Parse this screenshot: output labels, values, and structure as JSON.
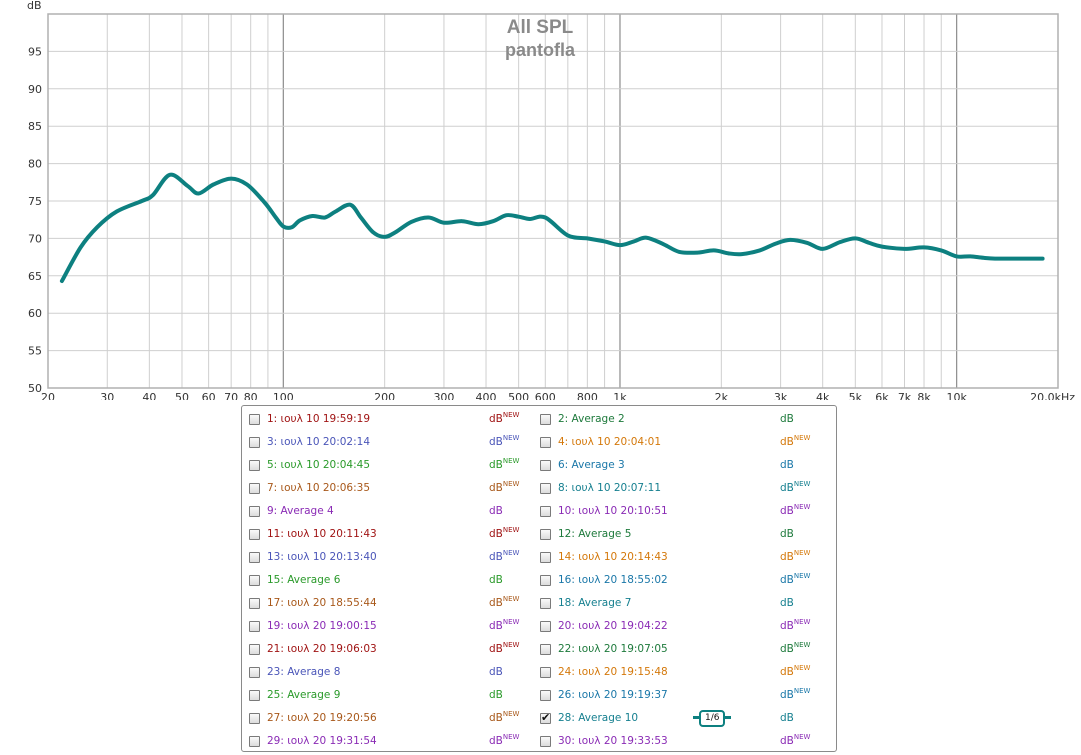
{
  "chart_data": {
    "type": "line",
    "title": "All SPL",
    "subtitle": "pantofla",
    "ylabel": "dB",
    "xlabel": "",
    "x_scale": "log",
    "xlim": [
      20,
      20000
    ],
    "ylim": [
      50,
      100
    ],
    "y_ticks": [
      50,
      55,
      60,
      65,
      70,
      75,
      80,
      85,
      90,
      95
    ],
    "x_ticks": [
      {
        "v": 20,
        "label": "20"
      },
      {
        "v": 30,
        "label": "30"
      },
      {
        "v": 40,
        "label": "40"
      },
      {
        "v": 50,
        "label": "50"
      },
      {
        "v": 60,
        "label": "60"
      },
      {
        "v": 70,
        "label": "70"
      },
      {
        "v": 80,
        "label": "80"
      },
      {
        "v": 100,
        "label": "100"
      },
      {
        "v": 200,
        "label": "200"
      },
      {
        "v": 300,
        "label": "300"
      },
      {
        "v": 400,
        "label": "400"
      },
      {
        "v": 500,
        "label": "500"
      },
      {
        "v": 600,
        "label": "600"
      },
      {
        "v": 800,
        "label": "800"
      },
      {
        "v": 1000,
        "label": "1k"
      },
      {
        "v": 2000,
        "label": "2k"
      },
      {
        "v": 3000,
        "label": "3k"
      },
      {
        "v": 4000,
        "label": "4k"
      },
      {
        "v": 5000,
        "label": "5k"
      },
      {
        "v": 6000,
        "label": "6k"
      },
      {
        "v": 7000,
        "label": "7k"
      },
      {
        "v": 8000,
        "label": "8k"
      },
      {
        "v": 10000,
        "label": "10k"
      },
      {
        "v": 20000,
        "label": "20,0kHz"
      }
    ],
    "grid": true,
    "series": [
      {
        "color": "#0d8080",
        "x": [
          22,
          25,
          28,
          32,
          38,
          41,
          46,
          52,
          56,
          62,
          70,
          78,
          88,
          95,
          100,
          106,
          112,
          122,
          133,
          143,
          158,
          170,
          185,
          200,
          215,
          240,
          270,
          300,
          340,
          380,
          420,
          460,
          500,
          540,
          600,
          700,
          800,
          900,
          1000,
          1100,
          1200,
          1350,
          1500,
          1700,
          1900,
          2100,
          2300,
          2600,
          2900,
          3200,
          3600,
          4000,
          4500,
          5000,
          5500,
          6000,
          7000,
          8000,
          9000,
          10000,
          11000,
          12000,
          13000,
          15000,
          18000
        ],
        "y": [
          64.3,
          68.8,
          71.5,
          73.6,
          75.0,
          75.8,
          78.5,
          77.0,
          76.0,
          77.2,
          78.0,
          77.2,
          74.8,
          72.8,
          71.6,
          71.5,
          72.4,
          73.0,
          72.8,
          73.6,
          74.5,
          72.8,
          70.8,
          70.2,
          70.8,
          72.2,
          72.8,
          72.1,
          72.3,
          71.9,
          72.3,
          73.1,
          72.9,
          72.6,
          72.8,
          70.4,
          70.0,
          69.6,
          69.1,
          69.6,
          70.1,
          69.2,
          68.2,
          68.1,
          68.4,
          68.0,
          67.9,
          68.4,
          69.3,
          69.8,
          69.4,
          68.6,
          69.5,
          70.0,
          69.4,
          68.9,
          68.6,
          68.8,
          68.4,
          67.6,
          67.6,
          67.4,
          67.3,
          67.3,
          67.3
        ]
      }
    ]
  },
  "legend": {
    "items": [
      {
        "label": "1: ιουλ 10 19:59:19",
        "color": "#a01414",
        "unit": "dB",
        "unit_new": "NEW",
        "unit_color": "#a01414",
        "checked": false
      },
      {
        "label": "2: Average 2",
        "color": "#1e7a3c",
        "unit": "dB",
        "unit_new": "",
        "unit_color": "#1e7a3c",
        "checked": false
      },
      {
        "label": "3: ιουλ 10 20:02:14",
        "color": "#4a55b8",
        "unit": "dB",
        "unit_new": "NEW",
        "unit_color": "#4a55b8",
        "checked": false
      },
      {
        "label": "4: ιουλ 10 20:04:01",
        "color": "#d4780a",
        "unit": "dB",
        "unit_new": "NEW",
        "unit_color": "#d4780a",
        "checked": false
      },
      {
        "label": "5: ιουλ 10 20:04:45",
        "color": "#2a9a2a",
        "unit": "dB",
        "unit_new": "NEW",
        "unit_color": "#2a9a2a",
        "checked": false
      },
      {
        "label": "6: Average 3",
        "color": "#1a77a8",
        "unit": "dB",
        "unit_new": "",
        "unit_color": "#1a77a8",
        "checked": false
      },
      {
        "label": "7: ιουλ 10 20:06:35",
        "color": "#a8581a",
        "unit": "dB",
        "unit_new": "NEW",
        "unit_color": "#a8581a",
        "checked": false
      },
      {
        "label": "8: ιουλ 10 20:07:11",
        "color": "#157f8f",
        "unit": "dB",
        "unit_new": "NEW",
        "unit_color": "#157f8f",
        "checked": false
      },
      {
        "label": "9: Average 4",
        "color": "#8a2bb5",
        "unit": "dB",
        "unit_new": "",
        "unit_color": "#8a2bb5",
        "checked": false
      },
      {
        "label": "10: ιουλ 10 20:10:51",
        "color": "#8a2bb5",
        "unit": "dB",
        "unit_new": "NEW",
        "unit_color": "#8a2bb5",
        "checked": false
      },
      {
        "label": "11: ιουλ 10 20:11:43",
        "color": "#a01414",
        "unit": "dB",
        "unit_new": "NEW",
        "unit_color": "#a01414",
        "checked": false
      },
      {
        "label": "12: Average 5",
        "color": "#1e7a3c",
        "unit": "dB",
        "unit_new": "",
        "unit_color": "#1e7a3c",
        "checked": false
      },
      {
        "label": "13: ιουλ 10 20:13:40",
        "color": "#4a55b8",
        "unit": "dB",
        "unit_new": "NEW",
        "unit_color": "#4a55b8",
        "checked": false
      },
      {
        "label": "14: ιουλ 10 20:14:43",
        "color": "#d4780a",
        "unit": "dB",
        "unit_new": "NEW",
        "unit_color": "#d4780a",
        "checked": false
      },
      {
        "label": "15: Average 6",
        "color": "#2a9a2a",
        "unit": "dB",
        "unit_new": "",
        "unit_color": "#2a9a2a",
        "checked": false
      },
      {
        "label": "16: ιουλ 20 18:55:02",
        "color": "#1a77a8",
        "unit": "dB",
        "unit_new": "NEW",
        "unit_color": "#1a77a8",
        "checked": false
      },
      {
        "label": "17: ιουλ 20 18:55:44",
        "color": "#a8581a",
        "unit": "dB",
        "unit_new": "NEW",
        "unit_color": "#a8581a",
        "checked": false
      },
      {
        "label": "18: Average 7",
        "color": "#157f8f",
        "unit": "dB",
        "unit_new": "",
        "unit_color": "#157f8f",
        "checked": false
      },
      {
        "label": "19: ιουλ 20 19:00:15",
        "color": "#8a2bb5",
        "unit": "dB",
        "unit_new": "NEW",
        "unit_color": "#8a2bb5",
        "checked": false
      },
      {
        "label": "20: ιουλ 20 19:04:22",
        "color": "#8a2bb5",
        "unit": "dB",
        "unit_new": "NEW",
        "unit_color": "#8a2bb5",
        "checked": false
      },
      {
        "label": "21: ιουλ 20 19:06:03",
        "color": "#a01414",
        "unit": "dB",
        "unit_new": "NEW",
        "unit_color": "#a01414",
        "checked": false
      },
      {
        "label": "22: ιουλ 20 19:07:05",
        "color": "#1e7a3c",
        "unit": "dB",
        "unit_new": "NEW",
        "unit_color": "#1e7a3c",
        "checked": false
      },
      {
        "label": "23: Average 8",
        "color": "#4a55b8",
        "unit": "dB",
        "unit_new": "",
        "unit_color": "#4a55b8",
        "checked": false
      },
      {
        "label": "24: ιουλ 20 19:15:48",
        "color": "#d4780a",
        "unit": "dB",
        "unit_new": "NEW",
        "unit_color": "#d4780a",
        "checked": false
      },
      {
        "label": "25: Average 9",
        "color": "#2a9a2a",
        "unit": "dB",
        "unit_new": "",
        "unit_color": "#2a9a2a",
        "checked": false
      },
      {
        "label": "26: ιουλ 20 19:19:37",
        "color": "#1a77a8",
        "unit": "dB",
        "unit_new": "NEW",
        "unit_color": "#1a77a8",
        "checked": false
      },
      {
        "label": "27: ιουλ 20 19:20:56",
        "color": "#a8581a",
        "unit": "dB",
        "unit_new": "NEW",
        "unit_color": "#a8581a",
        "checked": false
      },
      {
        "label": "28: Average 10",
        "color": "#157f8f",
        "unit": "dB",
        "unit_new": "",
        "unit_color": "#157f8f",
        "checked": true,
        "smoothing": "1/6"
      },
      {
        "label": "29: ιουλ 20 19:31:54",
        "color": "#8a2bb5",
        "unit": "dB",
        "unit_new": "NEW",
        "unit_color": "#8a2bb5",
        "checked": false
      },
      {
        "label": "30: ιουλ 20 19:33:53",
        "color": "#8a2bb5",
        "unit": "dB",
        "unit_new": "NEW",
        "unit_color": "#8a2bb5",
        "checked": false
      }
    ]
  }
}
